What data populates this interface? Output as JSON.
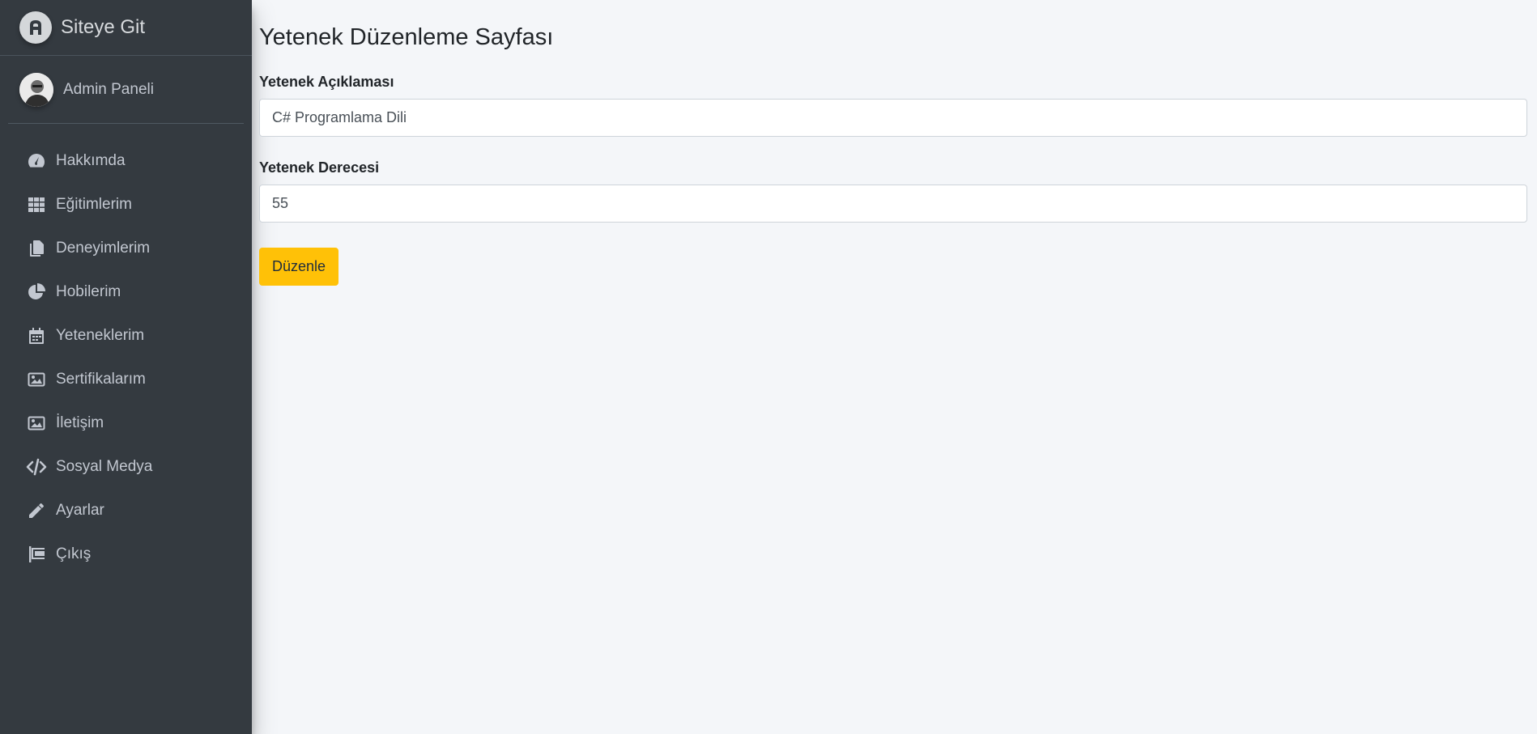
{
  "brand": {
    "text": "Siteye Git",
    "icon": "brand-logo-icon"
  },
  "user": {
    "name": "Admin Paneli"
  },
  "sidebar": {
    "items": [
      {
        "label": "Hakkımda",
        "icon": "tachometer-icon"
      },
      {
        "label": "Eğitimlerim",
        "icon": "grid-icon"
      },
      {
        "label": "Deneyimlerim",
        "icon": "copy-icon"
      },
      {
        "label": "Hobilerim",
        "icon": "chart-pie-icon"
      },
      {
        "label": "Yeteneklerim",
        "icon": "calendar-icon"
      },
      {
        "label": "Sertifikalarım",
        "icon": "image-icon"
      },
      {
        "label": "İletişim",
        "icon": "image-icon"
      },
      {
        "label": "Sosyal Medya",
        "icon": "code-icon"
      },
      {
        "label": "Ayarlar",
        "icon": "pencil-icon"
      },
      {
        "label": "Çıkış",
        "icon": "flag-icon"
      }
    ]
  },
  "main": {
    "title": "Yetenek Düzenleme Sayfası",
    "fields": {
      "description": {
        "label": "Yetenek Açıklaması",
        "value": "C# Programlama Dili"
      },
      "level": {
        "label": "Yetenek Derecesi",
        "value": "55"
      }
    },
    "submit_label": "Düzenle"
  },
  "colors": {
    "sidebar_bg": "#343a40",
    "content_bg": "#f4f6f9",
    "button_warning": "#ffc107",
    "sidebar_text": "#c2c7d0"
  }
}
